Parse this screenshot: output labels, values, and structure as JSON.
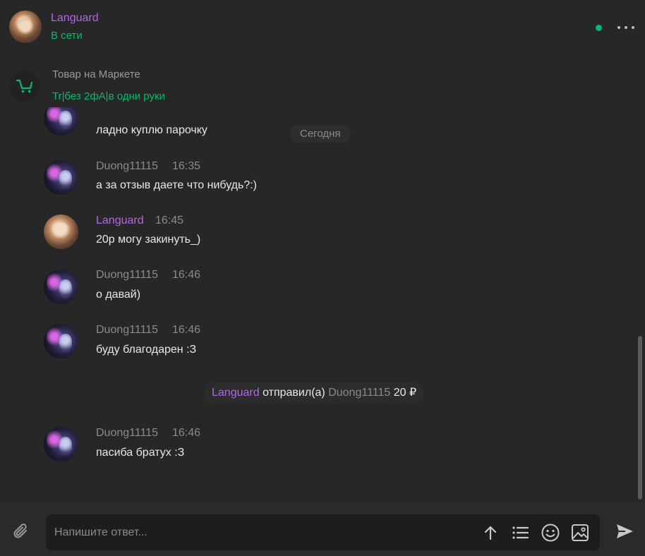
{
  "header": {
    "name": "Languard",
    "status": "В сети"
  },
  "product": {
    "title": "Товар на Маркете",
    "name": "Tr|без 2фА|в одни руки"
  },
  "date_separator": "Сегодня",
  "messages": [
    {
      "author": "",
      "time": "",
      "text": "ладно куплю парочку"
    },
    {
      "author": "Duong11115",
      "time": "16:35",
      "text": "а за отзыв даете что нибудь?:)"
    },
    {
      "author": "Languard",
      "time": "16:45",
      "text": "20р могу закинуть_)"
    },
    {
      "author": "Duong11115",
      "time": "16:46",
      "text": "о давай)"
    },
    {
      "author": "Duong11115",
      "time": "16:46",
      "text": "буду благодарен :З"
    },
    {
      "author": "Duong11115",
      "time": "16:46",
      "text": "пасиба братух :З"
    }
  ],
  "transfer": {
    "sender": "Languard",
    "action": "отправил(а)",
    "recipient": "Duong11115",
    "amount": "20 ₽"
  },
  "composer": {
    "placeholder": "Напишите ответ..."
  },
  "colors": {
    "background": "#272727",
    "accent_purple": "#b266e8",
    "online_green": "#00ba72",
    "muted_text": "#8a8a8a"
  },
  "icons": [
    "more-icon",
    "cart-icon",
    "paperclip-icon",
    "arrow-up-icon",
    "list-icon",
    "smiley-icon",
    "image-icon",
    "send-icon"
  ]
}
